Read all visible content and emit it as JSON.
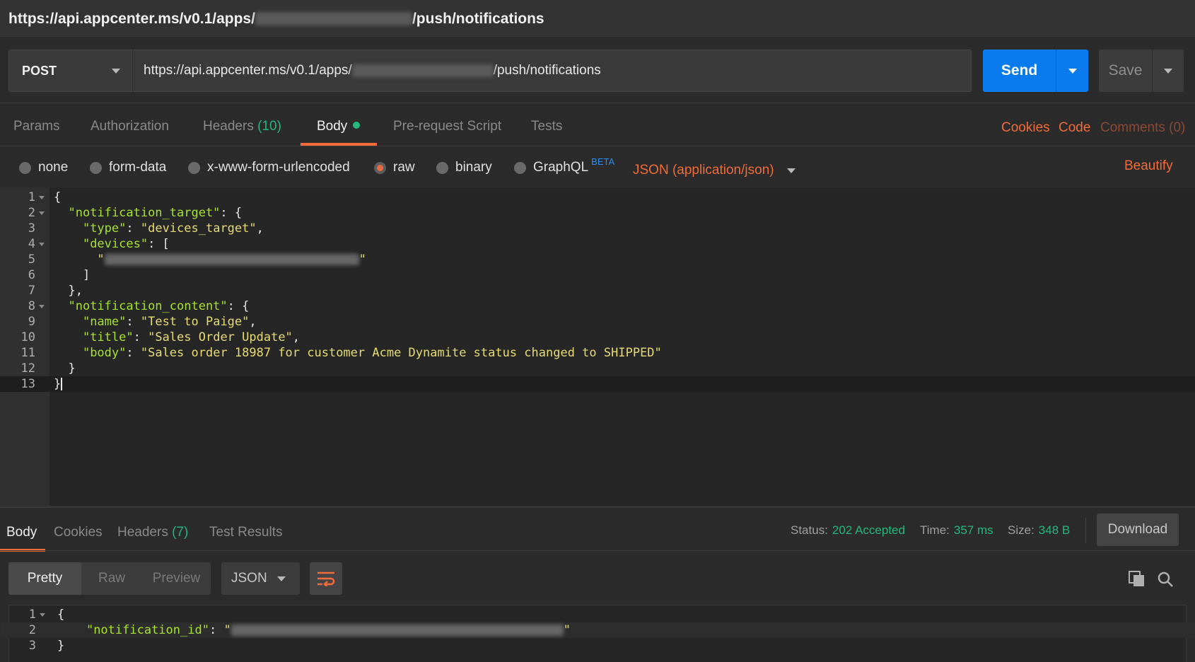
{
  "title": {
    "prefix": "https://api.appcenter.ms/v0.1/apps/",
    "suffix": "/push/notifications"
  },
  "request": {
    "method": "POST",
    "url_prefix": "https://api.appcenter.ms/v0.1/apps/",
    "url_suffix": "/push/notifications",
    "send_label": "Send",
    "save_label": "Save"
  },
  "request_tabs": [
    {
      "label": "Params"
    },
    {
      "label": "Authorization"
    },
    {
      "label": "Headers",
      "count": "(10)"
    },
    {
      "label": "Body"
    },
    {
      "label": "Pre-request Script"
    },
    {
      "label": "Tests"
    }
  ],
  "right_links": {
    "cookies": "Cookies",
    "code": "Code",
    "comments": "Comments (0)"
  },
  "body_modes": [
    "none",
    "form-data",
    "x-www-form-urlencoded",
    "raw",
    "binary",
    "GraphQL"
  ],
  "body_mode_selected": "raw",
  "graphql_badge": "BETA",
  "content_type": "JSON (application/json)",
  "beautify_label": "Beautify",
  "request_body": {
    "line_numbers": [
      "1",
      "2",
      "3",
      "4",
      "5",
      "6",
      "7",
      "8",
      "9",
      "10",
      "11",
      "12",
      "13"
    ],
    "keys": {
      "notification_target": "\"notification_target\"",
      "type": "\"type\"",
      "type_value": "\"devices_target\"",
      "devices": "\"devices\"",
      "notification_content": "\"notification_content\"",
      "name": "\"name\"",
      "name_value": "\"Test to Paige\"",
      "title": "\"title\"",
      "title_value": "\"Sales Order Update\"",
      "body": "\"body\"",
      "body_value": "\"Sales order 18987 for customer Acme Dynamite status changed to SHIPPED\""
    }
  },
  "response_tabs": [
    {
      "label": "Body"
    },
    {
      "label": "Cookies"
    },
    {
      "label": "Headers",
      "count": "(7)"
    },
    {
      "label": "Test Results"
    }
  ],
  "response_meta": {
    "status_label": "Status:",
    "status_value": "202 Accepted",
    "time_label": "Time:",
    "time_value": "357 ms",
    "size_label": "Size:",
    "size_value": "348 B"
  },
  "download_label": "Download",
  "view_modes": [
    "Pretty",
    "Raw",
    "Preview"
  ],
  "view_mode_selected": "Pretty",
  "response_format": "JSON",
  "response_body": {
    "line_numbers": [
      "1",
      "2",
      "3"
    ],
    "key": "\"notification_id\""
  },
  "colors": {
    "accent_orange": "#f26b3a",
    "send_blue": "#097bed",
    "success_green": "#26b47f",
    "json_key": "#a6e22e",
    "json_string": "#e6db74"
  },
  "icons": [
    "caret-down-icon",
    "wrap-lines-icon",
    "copy-icon",
    "search-icon"
  ]
}
